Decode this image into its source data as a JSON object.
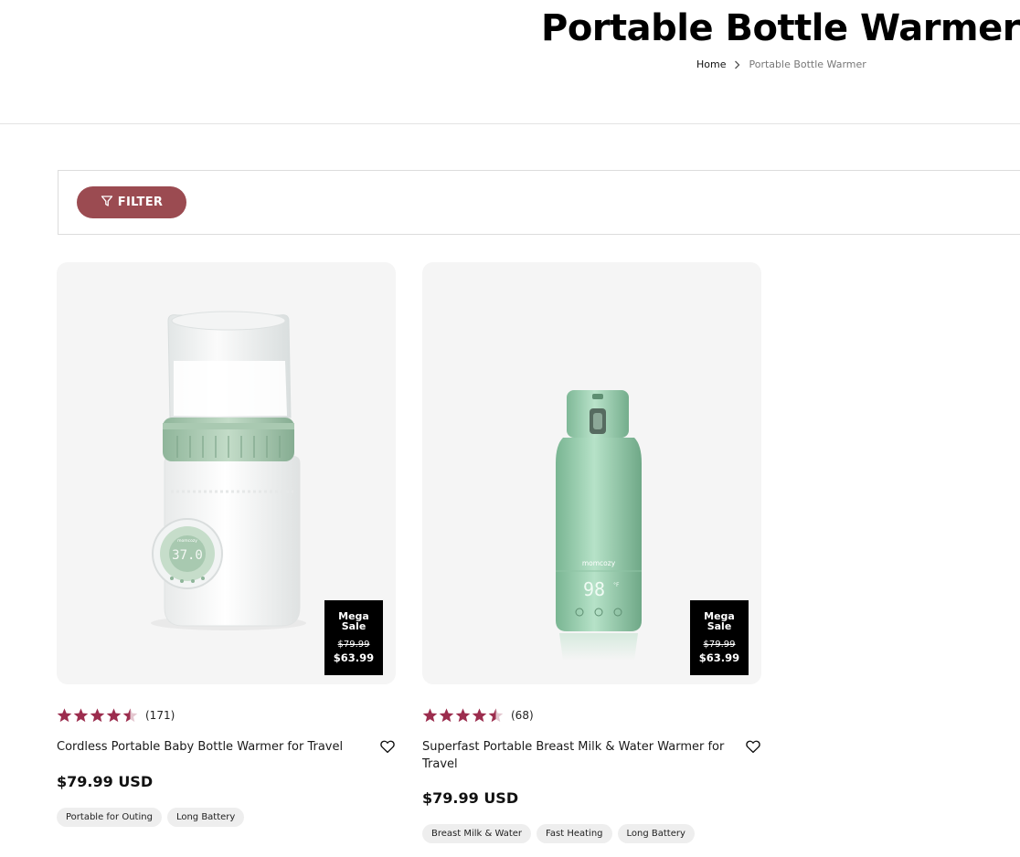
{
  "header": {
    "title": "Portable Bottle Warmer",
    "breadcrumb": {
      "home": "Home",
      "current": "Portable Bottle Warmer"
    }
  },
  "filter": {
    "label": "FILTER"
  },
  "colors": {
    "accent": "#9b4b51",
    "star": "#9c2d4e",
    "badge": "#000000",
    "card_bg": "#f5f5f5"
  },
  "products": [
    {
      "name": "Cordless Portable Baby Bottle Warmer for Travel",
      "rating": 4.5,
      "reviews": "(171)",
      "price": "$79.99 USD",
      "badge": {
        "label": "Mega Sale",
        "old_price": "$79.99",
        "new_price": "$63.99"
      },
      "tags": [
        "Portable for Outing",
        "Long Battery"
      ],
      "image_text": {
        "brand": "momcozy",
        "display": "37.0"
      }
    },
    {
      "name": "Superfast Portable Breast Milk & Water Warmer for Travel",
      "rating": 4.5,
      "reviews": "(68)",
      "price": "$79.99 USD",
      "badge": {
        "label": "Mega Sale",
        "old_price": "$79.99",
        "new_price": "$63.99"
      },
      "tags": [
        "Breast Milk & Water",
        "Fast Heating",
        "Long Battery"
      ],
      "image_text": {
        "brand": "momcozy",
        "display": "98",
        "unit": "°F"
      }
    }
  ]
}
